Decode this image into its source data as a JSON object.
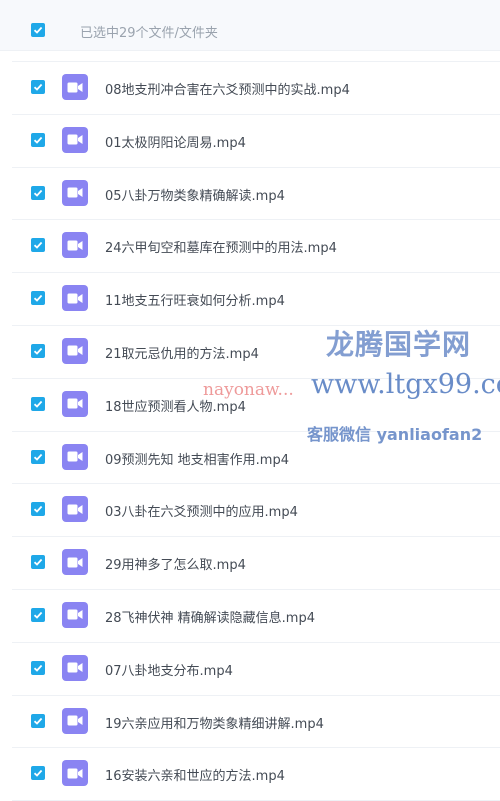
{
  "header": {
    "selected_text": "已选中29个文件/文件夹"
  },
  "files": [
    {
      "name": "08地支刑冲合害在六爻预测中的实战.mp4"
    },
    {
      "name": "01太极阴阳论周易.mp4"
    },
    {
      "name": "05八卦万物类象精确解读.mp4"
    },
    {
      "name": "24六甲旬空和墓库在预测中的用法.mp4"
    },
    {
      "name": "11地支五行旺衰如何分析.mp4"
    },
    {
      "name": "21取元忌仇用的方法.mp4"
    },
    {
      "name": "18世应预测看人物.mp4"
    },
    {
      "name": "09预测先知 地支相害作用.mp4"
    },
    {
      "name": "03八卦在六爻预测中的应用.mp4"
    },
    {
      "name": "29用神多了怎么取.mp4"
    },
    {
      "name": "28飞神伏神 精确解读隐藏信息.mp4"
    },
    {
      "name": "07八卦地支分布.mp4"
    },
    {
      "name": "19六亲应用和万物类象精细讲解.mp4"
    },
    {
      "name": "16安装六亲和世应的方法.mp4"
    }
  ],
  "watermark": {
    "title": "龙腾国学网",
    "url": "www.ltgx99.co",
    "service": "客服微信 yanliaofan2",
    "red_text": "nayonaw..."
  },
  "colors": {
    "checkbox": "#1fa8e8",
    "video_icon": "#8a84f2"
  }
}
